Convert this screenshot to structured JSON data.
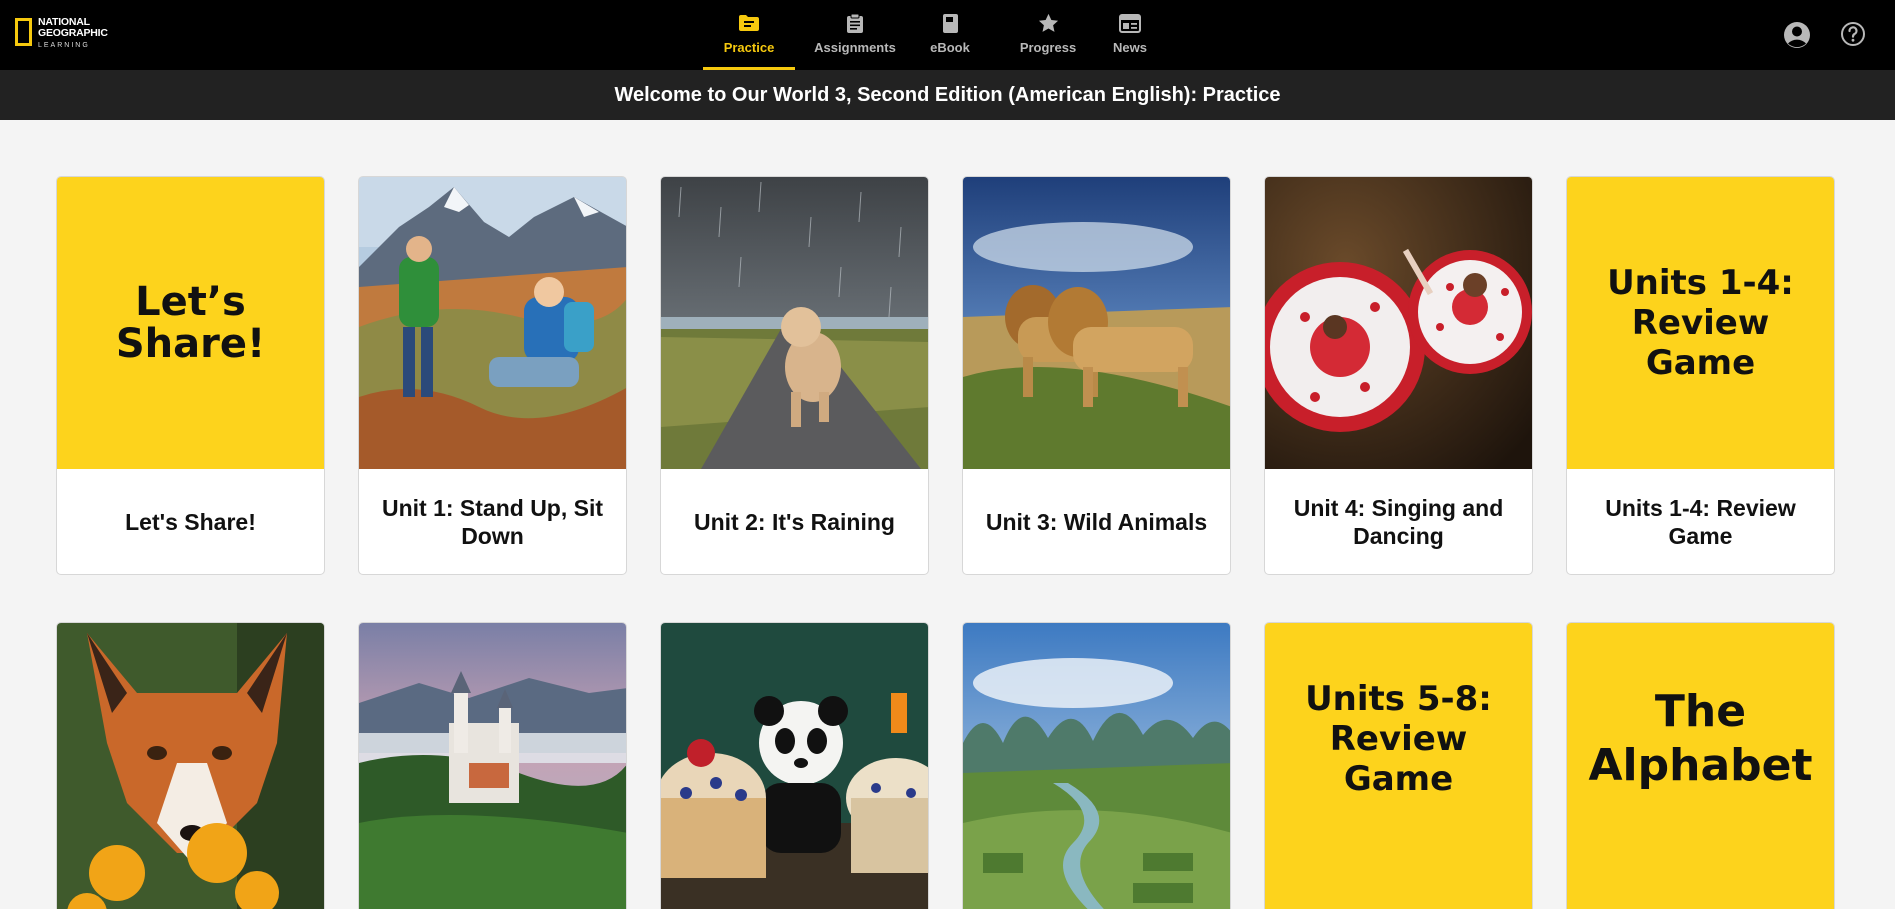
{
  "logo": {
    "line1": "NATIONAL",
    "line2": "GEOGRAPHIC",
    "line3": "LEARNING"
  },
  "nav": {
    "tabs": [
      {
        "label": "Practice",
        "icon": "folder-icon",
        "active": true
      },
      {
        "label": "Assignments",
        "icon": "clipboard-icon",
        "active": false
      },
      {
        "label": "eBook",
        "icon": "book-icon",
        "active": false
      },
      {
        "label": "Progress",
        "icon": "star-icon",
        "active": false
      },
      {
        "label": "News",
        "icon": "newspaper-icon",
        "active": false
      }
    ],
    "right_icons": [
      "user-account-icon",
      "help-icon"
    ]
  },
  "banner": {
    "title": "Welcome to Our World 3, Second Edition (American English): Practice"
  },
  "colors": {
    "accent": "#f6c90e",
    "tile_yellow": "#fdd31c",
    "nav_bg": "#000000",
    "banner_bg": "#222222"
  },
  "cards": [
    {
      "caption": "Let's Share!",
      "tile_text": "Let’s Share!",
      "image": "yellow-title-tile"
    },
    {
      "caption": "Unit 1: Stand Up, Sit Down",
      "image": "two-kids-hiking-mountains-photo"
    },
    {
      "caption": "Unit 2: It's Raining",
      "image": "dog-running-in-rain-photo"
    },
    {
      "caption": "Unit 3: Wild Animals",
      "image": "lions-on-hill-photo"
    },
    {
      "caption": "Unit 4: Singing and Dancing",
      "image": "dancers-in-red-dresses-photo"
    },
    {
      "caption": "Units 1-4: Review Game",
      "tile_text": "Units 1-4: Review Game",
      "image": "yellow-title-tile"
    },
    {
      "caption": "",
      "image": "fox-with-flowers-photo"
    },
    {
      "caption": "",
      "image": "castle-in-forest-photo"
    },
    {
      "caption": "",
      "image": "panda-with-cakes-photo"
    },
    {
      "caption": "",
      "image": "green-valley-river-photo"
    },
    {
      "caption": "",
      "tile_text": "Units 5-8: Review Game",
      "image": "yellow-title-tile"
    },
    {
      "caption": "",
      "tile_text": "The Alphabet",
      "image": "yellow-title-tile"
    }
  ]
}
